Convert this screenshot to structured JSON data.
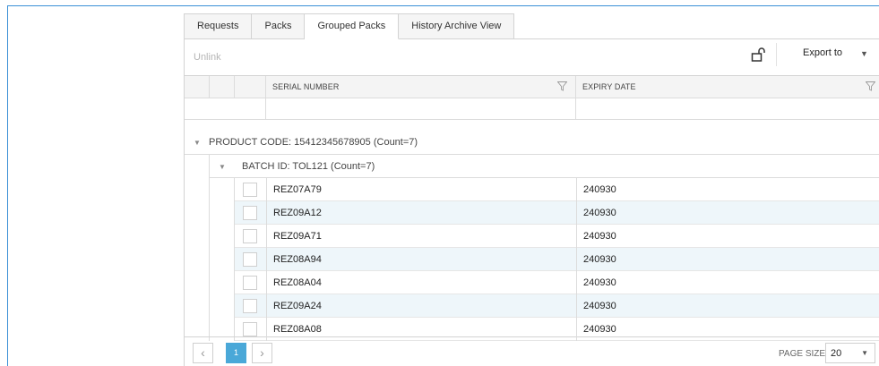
{
  "tabs": [
    {
      "label": "Requests"
    },
    {
      "label": "Packs"
    },
    {
      "label": "Grouped Packs"
    },
    {
      "label": "History Archive View"
    }
  ],
  "active_tab": "Grouped Packs",
  "toolbar": {
    "unlink_label": "Unlink",
    "lock_icon": "unlock-icon",
    "export_label": "Export to"
  },
  "columns": {
    "serial": "SERIAL NUMBER",
    "expiry": "EXPIRY DATE"
  },
  "groups": {
    "product": "PRODUCT CODE: 15412345678905 (Count=7)",
    "batch": "BATCH ID: TOL121 (Count=7)"
  },
  "rows": [
    {
      "serial": "REZ07A79",
      "expiry": "240930"
    },
    {
      "serial": "REZ09A12",
      "expiry": "240930"
    },
    {
      "serial": "REZ09A71",
      "expiry": "240930"
    },
    {
      "serial": "REZ08A94",
      "expiry": "240930"
    },
    {
      "serial": "REZ08A04",
      "expiry": "240930"
    },
    {
      "serial": "REZ09A24",
      "expiry": "240930"
    },
    {
      "serial": "REZ08A08",
      "expiry": "240930"
    }
  ],
  "pager": {
    "current_page": "1",
    "page_size_label": "PAGE SIZE",
    "page_size": "20"
  },
  "colors": {
    "accent": "#4aa8d8",
    "alt_row": "#eef6fa",
    "frame": "#3a8fd6"
  }
}
